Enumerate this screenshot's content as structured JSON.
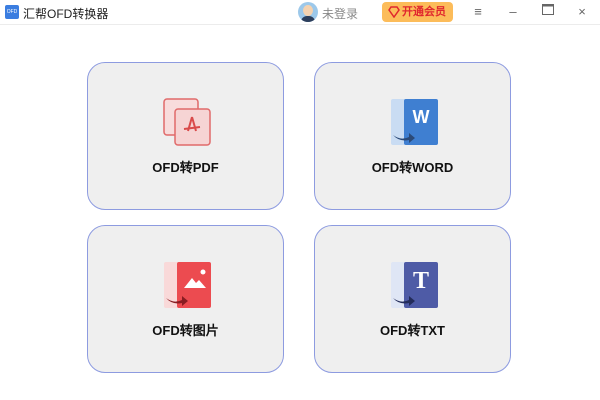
{
  "app": {
    "logo_text": "OFD",
    "title": "汇帮OFD转换器"
  },
  "header": {
    "login": "未登录",
    "vip": "开通会员",
    "menu_icon": "≡",
    "min_icon": "–",
    "max_icon": "□",
    "close_icon": "×"
  },
  "cards": [
    {
      "label": "OFD转PDF",
      "icon": "pdf-icon"
    },
    {
      "label": "OFD转WORD",
      "icon": "word-icon",
      "glyph": "W"
    },
    {
      "label": "OFD转图片",
      "icon": "image-icon"
    },
    {
      "label": "OFD转TXT",
      "icon": "txt-icon",
      "glyph": "T"
    }
  ]
}
